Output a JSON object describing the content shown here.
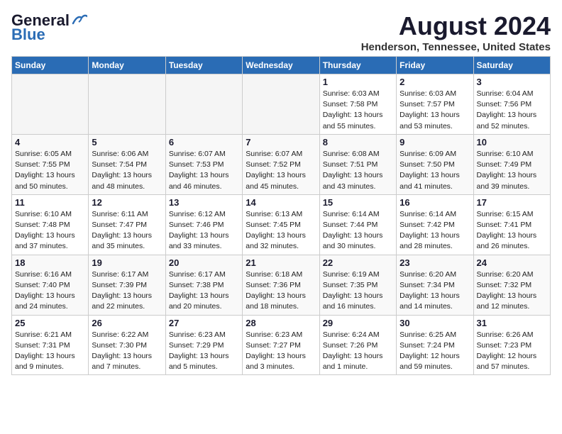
{
  "header": {
    "logo_line1": "General",
    "logo_line2": "Blue",
    "month_year": "August 2024",
    "location": "Henderson, Tennessee, United States"
  },
  "days_of_week": [
    "Sunday",
    "Monday",
    "Tuesday",
    "Wednesday",
    "Thursday",
    "Friday",
    "Saturday"
  ],
  "weeks": [
    [
      {
        "num": "",
        "info": ""
      },
      {
        "num": "",
        "info": ""
      },
      {
        "num": "",
        "info": ""
      },
      {
        "num": "",
        "info": ""
      },
      {
        "num": "1",
        "info": "Sunrise: 6:03 AM\nSunset: 7:58 PM\nDaylight: 13 hours\nand 55 minutes."
      },
      {
        "num": "2",
        "info": "Sunrise: 6:03 AM\nSunset: 7:57 PM\nDaylight: 13 hours\nand 53 minutes."
      },
      {
        "num": "3",
        "info": "Sunrise: 6:04 AM\nSunset: 7:56 PM\nDaylight: 13 hours\nand 52 minutes."
      }
    ],
    [
      {
        "num": "4",
        "info": "Sunrise: 6:05 AM\nSunset: 7:55 PM\nDaylight: 13 hours\nand 50 minutes."
      },
      {
        "num": "5",
        "info": "Sunrise: 6:06 AM\nSunset: 7:54 PM\nDaylight: 13 hours\nand 48 minutes."
      },
      {
        "num": "6",
        "info": "Sunrise: 6:07 AM\nSunset: 7:53 PM\nDaylight: 13 hours\nand 46 minutes."
      },
      {
        "num": "7",
        "info": "Sunrise: 6:07 AM\nSunset: 7:52 PM\nDaylight: 13 hours\nand 45 minutes."
      },
      {
        "num": "8",
        "info": "Sunrise: 6:08 AM\nSunset: 7:51 PM\nDaylight: 13 hours\nand 43 minutes."
      },
      {
        "num": "9",
        "info": "Sunrise: 6:09 AM\nSunset: 7:50 PM\nDaylight: 13 hours\nand 41 minutes."
      },
      {
        "num": "10",
        "info": "Sunrise: 6:10 AM\nSunset: 7:49 PM\nDaylight: 13 hours\nand 39 minutes."
      }
    ],
    [
      {
        "num": "11",
        "info": "Sunrise: 6:10 AM\nSunset: 7:48 PM\nDaylight: 13 hours\nand 37 minutes."
      },
      {
        "num": "12",
        "info": "Sunrise: 6:11 AM\nSunset: 7:47 PM\nDaylight: 13 hours\nand 35 minutes."
      },
      {
        "num": "13",
        "info": "Sunrise: 6:12 AM\nSunset: 7:46 PM\nDaylight: 13 hours\nand 33 minutes."
      },
      {
        "num": "14",
        "info": "Sunrise: 6:13 AM\nSunset: 7:45 PM\nDaylight: 13 hours\nand 32 minutes."
      },
      {
        "num": "15",
        "info": "Sunrise: 6:14 AM\nSunset: 7:44 PM\nDaylight: 13 hours\nand 30 minutes."
      },
      {
        "num": "16",
        "info": "Sunrise: 6:14 AM\nSunset: 7:42 PM\nDaylight: 13 hours\nand 28 minutes."
      },
      {
        "num": "17",
        "info": "Sunrise: 6:15 AM\nSunset: 7:41 PM\nDaylight: 13 hours\nand 26 minutes."
      }
    ],
    [
      {
        "num": "18",
        "info": "Sunrise: 6:16 AM\nSunset: 7:40 PM\nDaylight: 13 hours\nand 24 minutes."
      },
      {
        "num": "19",
        "info": "Sunrise: 6:17 AM\nSunset: 7:39 PM\nDaylight: 13 hours\nand 22 minutes."
      },
      {
        "num": "20",
        "info": "Sunrise: 6:17 AM\nSunset: 7:38 PM\nDaylight: 13 hours\nand 20 minutes."
      },
      {
        "num": "21",
        "info": "Sunrise: 6:18 AM\nSunset: 7:36 PM\nDaylight: 13 hours\nand 18 minutes."
      },
      {
        "num": "22",
        "info": "Sunrise: 6:19 AM\nSunset: 7:35 PM\nDaylight: 13 hours\nand 16 minutes."
      },
      {
        "num": "23",
        "info": "Sunrise: 6:20 AM\nSunset: 7:34 PM\nDaylight: 13 hours\nand 14 minutes."
      },
      {
        "num": "24",
        "info": "Sunrise: 6:20 AM\nSunset: 7:32 PM\nDaylight: 13 hours\nand 12 minutes."
      }
    ],
    [
      {
        "num": "25",
        "info": "Sunrise: 6:21 AM\nSunset: 7:31 PM\nDaylight: 13 hours\nand 9 minutes."
      },
      {
        "num": "26",
        "info": "Sunrise: 6:22 AM\nSunset: 7:30 PM\nDaylight: 13 hours\nand 7 minutes."
      },
      {
        "num": "27",
        "info": "Sunrise: 6:23 AM\nSunset: 7:29 PM\nDaylight: 13 hours\nand 5 minutes."
      },
      {
        "num": "28",
        "info": "Sunrise: 6:23 AM\nSunset: 7:27 PM\nDaylight: 13 hours\nand 3 minutes."
      },
      {
        "num": "29",
        "info": "Sunrise: 6:24 AM\nSunset: 7:26 PM\nDaylight: 13 hours\nand 1 minute."
      },
      {
        "num": "30",
        "info": "Sunrise: 6:25 AM\nSunset: 7:24 PM\nDaylight: 12 hours\nand 59 minutes."
      },
      {
        "num": "31",
        "info": "Sunrise: 6:26 AM\nSunset: 7:23 PM\nDaylight: 12 hours\nand 57 minutes."
      }
    ]
  ]
}
